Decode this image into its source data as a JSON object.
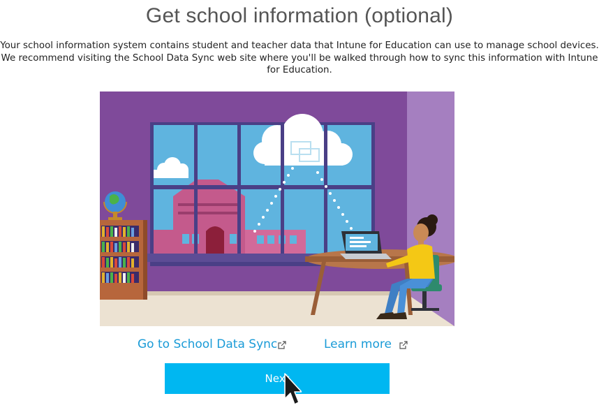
{
  "page": {
    "title": "Get school information (optional)",
    "description_lines": [
      "Your school information system contains student and teacher data that Intune for Education can use to manage school devices.",
      "We recommend visiting the School Data Sync web site where you'll be walked through how to sync this information with Intune",
      "for Education."
    ]
  },
  "links": {
    "school_data_sync": "Go to School Data Sync",
    "learn_more": "Learn more"
  },
  "icons": {
    "external_link": "external-link-icon",
    "cursor": "mouse-pointer-icon"
  },
  "buttons": {
    "next": "Next"
  },
  "colors": {
    "accent": "#00b7f1",
    "link": "#1a9bd7",
    "title": "#555555",
    "illustration_wall": "#7f4a9a",
    "illustration_sky": "#5fb4df",
    "illustration_building": "#c45a8c",
    "illustration_shirt": "#f4c815"
  }
}
